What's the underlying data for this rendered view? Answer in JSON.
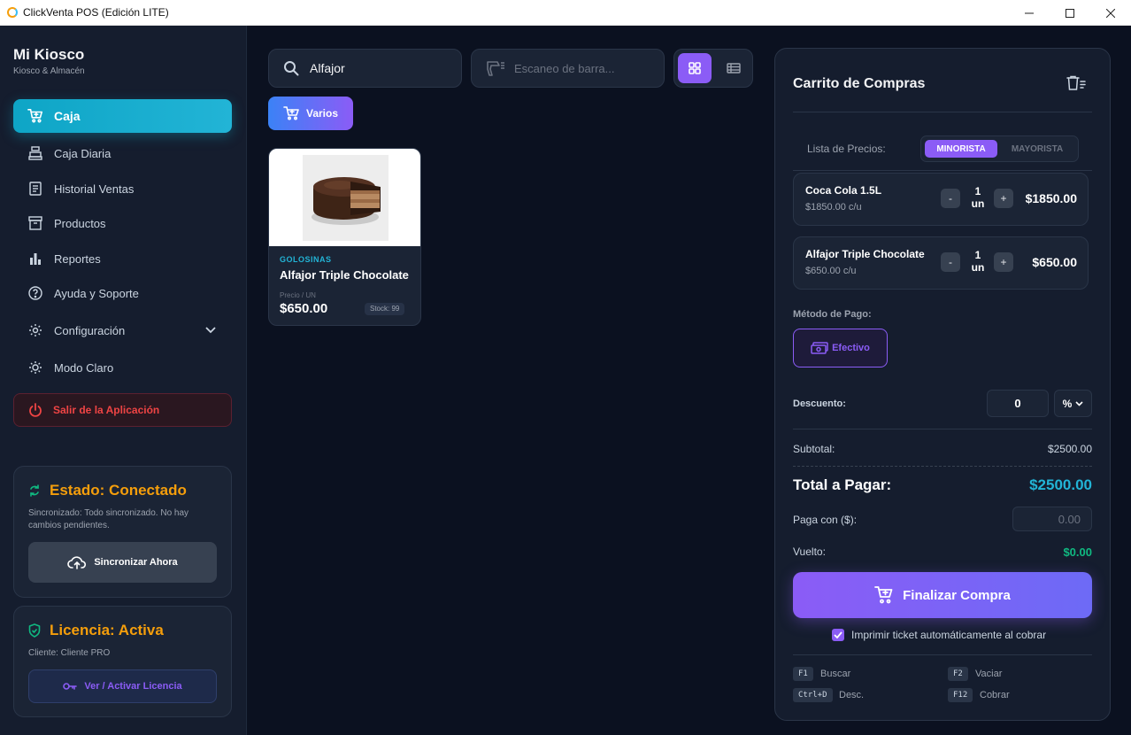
{
  "window": {
    "title": "ClickVenta POS (Edición LITE)",
    "controls": {
      "minimize": "—",
      "maximize": "☐",
      "close": "✕"
    }
  },
  "sidebar": {
    "brand_name": "Mi Kiosco",
    "brand_sub": "Kiosco & Almacén",
    "items": [
      {
        "label": "Caja",
        "icon": "cart-icon",
        "active": true
      },
      {
        "label": "Caja Diaria",
        "icon": "register-icon"
      },
      {
        "label": "Historial Ventas",
        "icon": "receipt-icon"
      },
      {
        "label": "Productos",
        "icon": "archive-icon"
      },
      {
        "label": "Reportes",
        "icon": "bar-chart-icon"
      },
      {
        "label": "Ayuda y Soporte",
        "icon": "help-icon"
      },
      {
        "label": "Configuración",
        "icon": "gear-icon"
      },
      {
        "label": "Modo Claro",
        "icon": "sun-icon"
      }
    ],
    "logout_label": "Salir de la Aplicación",
    "status": {
      "title": "Estado: Conectado",
      "description": "Sincronizado: Todo sincronizado. No hay cambios pendientes.",
      "button": "Sincronizar Ahora"
    },
    "license": {
      "title": "Licencia: Activa",
      "client": "Cliente: Cliente PRO",
      "button": "Ver / Activar Licencia"
    }
  },
  "main": {
    "search_value": "Alfajor",
    "scan_placeholder": "Escaneo de barra...",
    "varios_label": "Varios",
    "products": [
      {
        "category": "GOLOSINAS",
        "name": "Alfajor Triple Chocolate",
        "price_label": "Precio / UN",
        "price": "$650.00",
        "stock": "Stock: 99"
      }
    ]
  },
  "cart": {
    "title": "Carrito de Compras",
    "price_list_label": "Lista de Precios:",
    "price_list_options": [
      "MINORISTA",
      "MAYORISTA"
    ],
    "price_list_selected": "MINORISTA",
    "items": [
      {
        "name": "Coca Cola 1.5L",
        "unit_price": "$1850.00 c/u",
        "qty": "1",
        "unit": "un",
        "total": "$1850.00"
      },
      {
        "name": "Alfajor Triple Chocolate",
        "unit_price": "$650.00 c/u",
        "qty": "1",
        "unit": "un",
        "total": "$650.00"
      }
    ],
    "qty_minus": "-",
    "qty_plus": "+",
    "payment_label": "Método de Pago:",
    "payment_method": "Efectivo",
    "discount_label": "Descuento:",
    "discount_value": "0",
    "discount_type": "%",
    "subtotal_label": "Subtotal:",
    "subtotal": "$2500.00",
    "total_label": "Total a Pagar:",
    "total": "$2500.00",
    "paga_con_label": "Paga con ($):",
    "paga_con_placeholder": "0.00",
    "vuelto_label": "Vuelto:",
    "vuelto": "$0.00",
    "finalize_label": "Finalizar Compra",
    "print_label": "Imprimir ticket automáticamente al cobrar",
    "print_checked": true,
    "shortcuts": [
      {
        "key": "F1",
        "label": "Buscar"
      },
      {
        "key": "F2",
        "label": "Vaciar"
      },
      {
        "key": "Ctrl+D",
        "label": "Desc."
      },
      {
        "key": "F12",
        "label": "Cobrar"
      }
    ]
  },
  "colors": {
    "accent_cyan": "#0ea5c6",
    "accent_purple": "#8b5cf6",
    "warning_orange": "#f59e0b",
    "danger_red": "#ef4444",
    "success_green": "#10b981",
    "background": "#0b1120",
    "panel": "#151d2e"
  }
}
